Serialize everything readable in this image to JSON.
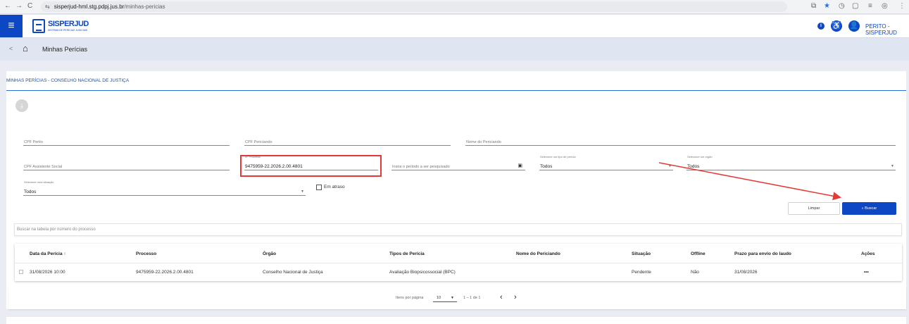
{
  "browser": {
    "back": "←",
    "forward": "→",
    "reload": "C",
    "tune": "⇆",
    "url_host": "sisperjud-hml.stg.pdpj.jus.br",
    "url_path": "/minhas-pericias"
  },
  "header": {
    "logo_name": "SISPERJUD",
    "logo_sub": "SISTEMA DE PERÍCIAS JUDICIAIS",
    "user_name": "PERITO - SISPERJUD"
  },
  "breadcrumb": {
    "back": "<",
    "home": "⌂",
    "title": "Minhas Perícias"
  },
  "card": {
    "title": "MINHAS PERÍCIAS - CONSELHO NACIONAL DE JUSTIÇA",
    "download_icon": "⤓"
  },
  "filters": {
    "cpf_perito": "CPF Perito",
    "cpf_periciando": "CPF Periciando",
    "nome_periciando": "Nome do Periciando",
    "cpf_assistente": "CPF Assistente Social",
    "processo_label": "Nº Processo",
    "processo_value": "9475959-22.2026.2.00.4801",
    "periodo": "Insira o período a ser pesquisado",
    "tipo_label": "Selecione um tipo de perícia",
    "tipo_value": "Todos",
    "orgao_label": "Selecione um órgão",
    "orgao_value": "Todos",
    "situacao_label": "Selecione uma situação",
    "situacao_value": "Todos",
    "em_atraso": "Em atraso"
  },
  "actions": {
    "limpar": "Limpar",
    "buscar": "Buscar",
    "buscar_icon": "🔍"
  },
  "table": {
    "search_placeholder": "Buscar na tabela por número do processo",
    "headers": [
      "Data da Perícia ↑",
      "Processo",
      "Órgão",
      "Tipos de Perícia",
      "Nome do Periciando",
      "Situação",
      "Offline",
      "Prazo para envio do laudo",
      "Ações"
    ],
    "rows": [
      [
        "31/08/2026 10:00",
        "9475959-22.2026.2.00.4801",
        "Conselho Nacional de Justiça",
        "Avaliação Biopsicossocial (BPC)",
        "",
        "Pendente",
        "Não",
        "31/08/2026",
        "•••"
      ]
    ]
  },
  "pagination": {
    "items_label": "Itens por página",
    "page_size": "10",
    "range": "1 – 1 de 1",
    "prev": "‹",
    "next": "›"
  },
  "colors": {
    "primary": "#0d47c4",
    "highlight": "#e53935"
  }
}
